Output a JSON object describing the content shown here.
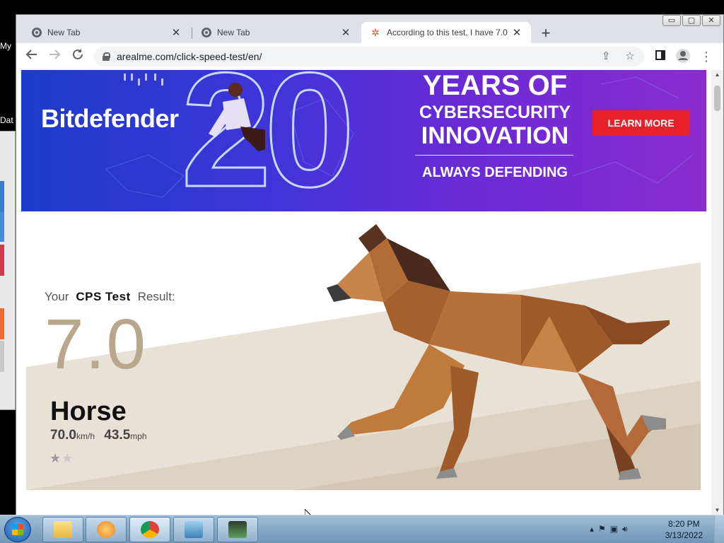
{
  "desktop": {
    "icon_labels": [
      "My",
      "Dat"
    ]
  },
  "browser": {
    "tabs": [
      {
        "title": "New Tab",
        "active": false
      },
      {
        "title": "New Tab",
        "active": false
      },
      {
        "title": "According to this test, I have 7.0",
        "active": true
      }
    ],
    "url": "arealme.com/click-speed-test/en/",
    "window_controls": {
      "minimize": "▭",
      "maximize": "▢",
      "close": "✕"
    }
  },
  "ad": {
    "brand": "Bitdefender",
    "big_number": "20",
    "headline_1": "YEARS OF",
    "headline_2": "CYBERSECURITY",
    "headline_3": "INNOVATION",
    "tagline": "ALWAYS DEFENDING",
    "cta": "LEARN MORE",
    "colors": {
      "cta": "#e8202a",
      "bg_start": "#1d3cc9",
      "bg_end": "#8a2ccf"
    }
  },
  "result": {
    "prefix": "Your",
    "test_name": "CPS Test",
    "suffix": "Result:",
    "score": "7.0",
    "animal": "Horse",
    "speed_kmh": "70.0",
    "unit_kmh": "km/h",
    "speed_mph": "43.5",
    "unit_mph": "mph",
    "stars_filled": "★",
    "stars_empty": "★",
    "rating": {
      "filled": 1,
      "total": 2
    },
    "colors": {
      "score": "#b8a78c",
      "horse": "#b2692f"
    }
  },
  "taskbar": {
    "time": "8:20 PM",
    "date": "3/13/2022",
    "apps": [
      "explorer",
      "media-player",
      "chrome",
      "photos",
      "task-manager"
    ]
  }
}
